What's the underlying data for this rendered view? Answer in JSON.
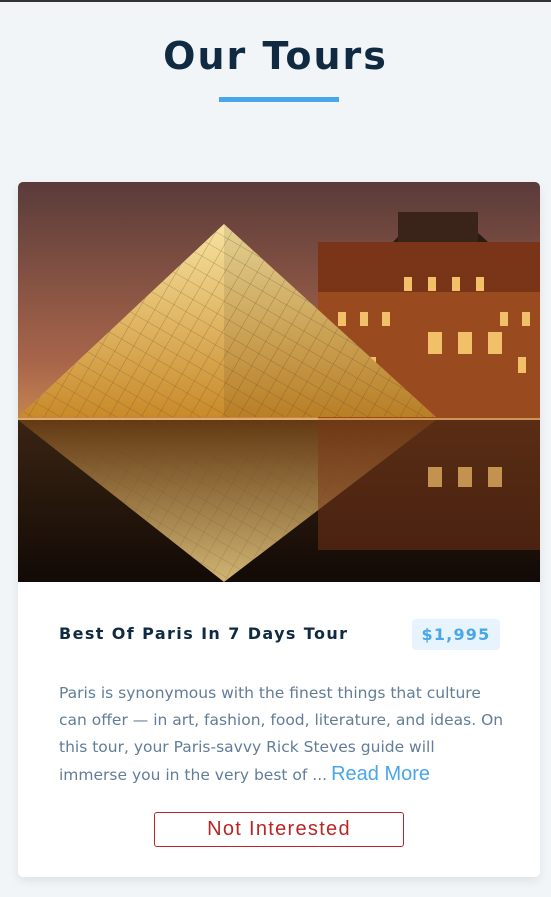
{
  "page": {
    "title": "Our Tours"
  },
  "tour": {
    "name": "Best Of Paris In 7 Days Tour",
    "price": "$1,995",
    "description": "Paris is synonymous with the finest things that culture can offer — in art, fashion, food, literature, and ideas. On this tour, your Paris-savvy Rick Steves guide will immerse you in the very best of ...",
    "read_more_label": "Read More",
    "not_interested_label": "Not Interested"
  },
  "colors": {
    "heading": "#102a42",
    "accent": "#49a6e9",
    "price_bg": "#e8f4fd",
    "body_text": "#617d98",
    "danger": "#bb2525",
    "page_bg": "#f1f5f8"
  }
}
